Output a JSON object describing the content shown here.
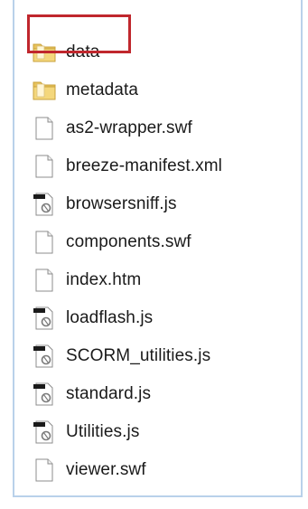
{
  "files": [
    {
      "name": "data",
      "icon": "folder-icon",
      "kind": "folder"
    },
    {
      "name": "metadata",
      "icon": "folder-icon",
      "kind": "folder"
    },
    {
      "name": "as2-wrapper.swf",
      "icon": "blank-file-icon",
      "kind": "file"
    },
    {
      "name": "breeze-manifest.xml",
      "icon": "blank-file-icon",
      "kind": "file"
    },
    {
      "name": "browsersniff.js",
      "icon": "script-file-icon",
      "kind": "script"
    },
    {
      "name": "components.swf",
      "icon": "blank-file-icon",
      "kind": "file"
    },
    {
      "name": "index.htm",
      "icon": "blank-file-icon",
      "kind": "file"
    },
    {
      "name": "loadflash.js",
      "icon": "script-file-icon",
      "kind": "script"
    },
    {
      "name": "SCORM_utilities.js",
      "icon": "script-file-icon",
      "kind": "script"
    },
    {
      "name": "standard.js",
      "icon": "script-file-icon",
      "kind": "script"
    },
    {
      "name": "Utilities.js",
      "icon": "script-file-icon",
      "kind": "script"
    },
    {
      "name": "viewer.swf",
      "icon": "blank-file-icon",
      "kind": "file"
    }
  ],
  "highlight": {
    "target": "data",
    "color": "#c0272d"
  },
  "colors": {
    "pane_border": "#b9d1ea",
    "folder": "#e8c25a",
    "text": "#1a1a1a"
  }
}
